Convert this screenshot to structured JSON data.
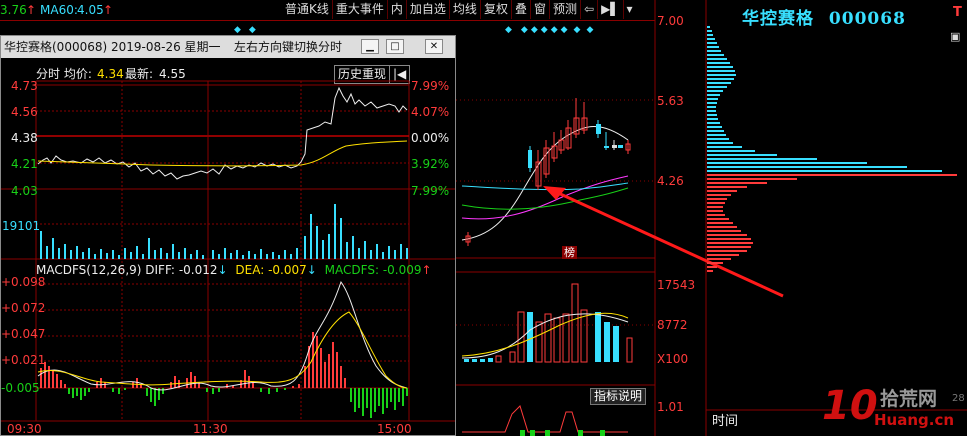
{
  "topbar": {
    "ma_left_value": "3.76",
    "ma60_label": "MA60:",
    "ma60_value": "4.05",
    "arrow_up": "↑"
  },
  "toolbar": {
    "items": [
      "普通K线",
      "重大事件",
      "内",
      "加自选",
      "均线",
      "复权",
      "叠",
      "窗",
      "预测"
    ]
  },
  "stock_header": {
    "name": "华控赛格",
    "code": "000068",
    "flag": "T"
  },
  "main_price_scale": {
    "p1": "7.00",
    "p2": "5.63",
    "p3": "4.26"
  },
  "volume_scale": {
    "v1": "17543",
    "v2": "8772",
    "unit": "X100"
  },
  "badges": {
    "bang": "榜"
  },
  "indicator": {
    "button_label": "指标说明",
    "value": "1.01"
  },
  "chips_panel": {
    "time_label": "时间"
  },
  "watermark": {
    "digits": "10",
    "cn": "拾荒网",
    "domain": "Huang.cn",
    "partial_num": "28"
  },
  "intraday_window": {
    "title": "华控赛格(000068) 2019-08-26 星期一",
    "hint": "左右方向键切换分时",
    "min_btn": "▁",
    "max_btn": "□",
    "close_btn": "✕",
    "info_label": "分时 均价:",
    "avg_price": "4.34",
    "latest_label": "最新:",
    "latest_price": "4.55",
    "history_btn": "历史重现",
    "price_ticks_left": [
      "4.73",
      "4.56",
      "4.38",
      "4.21",
      "4.03"
    ],
    "pct_ticks_right": [
      "7.99%",
      "4.07%",
      "0.00%",
      "3.92%",
      "7.99%"
    ],
    "volume_max": "19101",
    "macd_label": "MACDFS(12,26,9)",
    "diff_label": "DIFF:",
    "diff_value": "-0.012",
    "dea_label": "DEA:",
    "dea_value": "-0.007",
    "macdfs_label": "MACDFS:",
    "macdfs_value": "-0.009",
    "macd_ticks": [
      "+0.098",
      "+0.072",
      "+0.047",
      "+0.021",
      "-0.005"
    ],
    "time_ticks": [
      "09:30",
      "11:30",
      "15:00"
    ]
  },
  "colors": {
    "up": "#ff3b3b",
    "down": "#38dfff",
    "grid": "#8a0000",
    "background": "#000000"
  }
}
